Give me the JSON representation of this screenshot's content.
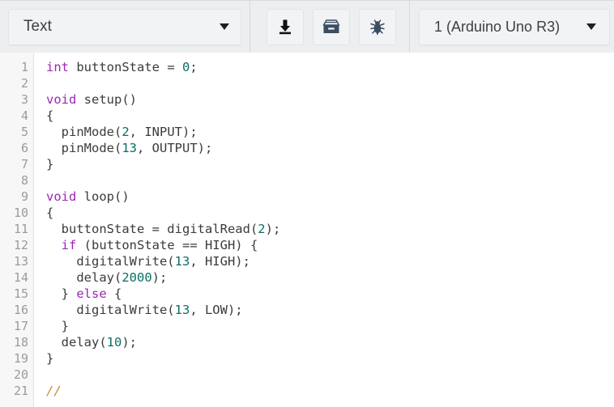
{
  "toolbar": {
    "mode_dropdown": {
      "name": "mode-selector",
      "value": "Text",
      "icon": "chevron-down-icon"
    },
    "buttons": [
      {
        "name": "download-button",
        "icon": "download-icon",
        "label": "Download"
      },
      {
        "name": "archive-button",
        "icon": "archive-icon",
        "label": "Archive"
      },
      {
        "name": "debug-button",
        "icon": "bug-icon",
        "label": "Debug"
      }
    ],
    "board_dropdown": {
      "name": "board-selector",
      "value": "1 (Arduino Uno R3)",
      "icon": "chevron-down-icon"
    }
  },
  "editor": {
    "line_numbers": [
      "1",
      "2",
      "3",
      "4",
      "5",
      "6",
      "7",
      "8",
      "9",
      "10",
      "11",
      "12",
      "13",
      "14",
      "15",
      "16",
      "17",
      "18",
      "19",
      "20",
      "21"
    ],
    "lines": [
      {
        "n": "1",
        "text": "int buttonState = 0;"
      },
      {
        "n": "2",
        "text": ""
      },
      {
        "n": "3",
        "text": "void setup()"
      },
      {
        "n": "4",
        "text": "{"
      },
      {
        "n": "5",
        "text": "  pinMode(2, INPUT);"
      },
      {
        "n": "6",
        "text": "  pinMode(13, OUTPUT);"
      },
      {
        "n": "7",
        "text": "}"
      },
      {
        "n": "8",
        "text": ""
      },
      {
        "n": "9",
        "text": "void loop()"
      },
      {
        "n": "10",
        "text": "{"
      },
      {
        "n": "11",
        "text": "  buttonState = digitalRead(2);"
      },
      {
        "n": "12",
        "text": "  if (buttonState == HIGH) {"
      },
      {
        "n": "13",
        "text": "    digitalWrite(13, HIGH);"
      },
      {
        "n": "14",
        "text": "    delay(2000);"
      },
      {
        "n": "15",
        "text": "  } else {"
      },
      {
        "n": "16",
        "text": "    digitalWrite(13, LOW);"
      },
      {
        "n": "17",
        "text": "  }"
      },
      {
        "n": "18",
        "text": "  delay(10);"
      },
      {
        "n": "19",
        "text": "}"
      },
      {
        "n": "20",
        "text": ""
      },
      {
        "n": "21",
        "text": "//"
      }
    ],
    "tokens": [
      [
        {
          "t": "kw",
          "v": "int"
        },
        {
          "t": "pln",
          "v": " buttonState = "
        },
        {
          "t": "num",
          "v": "0"
        },
        {
          "t": "pln",
          "v": ";"
        }
      ],
      [
        {
          "t": "pln",
          "v": ""
        }
      ],
      [
        {
          "t": "kw",
          "v": "void"
        },
        {
          "t": "pln",
          "v": " setup()"
        }
      ],
      [
        {
          "t": "pln",
          "v": "{"
        }
      ],
      [
        {
          "t": "pln",
          "v": "  pinMode("
        },
        {
          "t": "num",
          "v": "2"
        },
        {
          "t": "pln",
          "v": ", INPUT);"
        }
      ],
      [
        {
          "t": "pln",
          "v": "  pinMode("
        },
        {
          "t": "num",
          "v": "13"
        },
        {
          "t": "pln",
          "v": ", OUTPUT);"
        }
      ],
      [
        {
          "t": "pln",
          "v": "}"
        }
      ],
      [
        {
          "t": "pln",
          "v": ""
        }
      ],
      [
        {
          "t": "kw",
          "v": "void"
        },
        {
          "t": "pln",
          "v": " loop()"
        }
      ],
      [
        {
          "t": "pln",
          "v": "{"
        }
      ],
      [
        {
          "t": "pln",
          "v": "  buttonState = digitalRead("
        },
        {
          "t": "num",
          "v": "2"
        },
        {
          "t": "pln",
          "v": ");"
        }
      ],
      [
        {
          "t": "pln",
          "v": "  "
        },
        {
          "t": "kw",
          "v": "if"
        },
        {
          "t": "pln",
          "v": " (buttonState == HIGH) {"
        }
      ],
      [
        {
          "t": "pln",
          "v": "    digitalWrite("
        },
        {
          "t": "num",
          "v": "13"
        },
        {
          "t": "pln",
          "v": ", HIGH);"
        }
      ],
      [
        {
          "t": "pln",
          "v": "    delay("
        },
        {
          "t": "num",
          "v": "2000"
        },
        {
          "t": "pln",
          "v": ");"
        }
      ],
      [
        {
          "t": "pln",
          "v": "  } "
        },
        {
          "t": "kw",
          "v": "else"
        },
        {
          "t": "pln",
          "v": " {"
        }
      ],
      [
        {
          "t": "pln",
          "v": "    digitalWrite("
        },
        {
          "t": "num",
          "v": "13"
        },
        {
          "t": "pln",
          "v": ", LOW);"
        }
      ],
      [
        {
          "t": "pln",
          "v": "  }"
        }
      ],
      [
        {
          "t": "pln",
          "v": "  delay("
        },
        {
          "t": "num",
          "v": "10"
        },
        {
          "t": "pln",
          "v": ");"
        }
      ],
      [
        {
          "t": "pln",
          "v": "}"
        }
      ],
      [
        {
          "t": "pln",
          "v": ""
        }
      ],
      [
        {
          "t": "com",
          "v": "//"
        }
      ]
    ]
  },
  "colors": {
    "toolbar_bg": "#eceef0",
    "control_bg": "#f2f3f5",
    "control_border": "#e2e4e8",
    "icon": "#3b4d63",
    "editor_bg": "#ffffff",
    "gutter_bg": "#f7f7f7",
    "gutter_text": "#9b9b9b",
    "code_text": "#3b3b3b",
    "keyword": "#9b26b6",
    "number": "#0b6e64",
    "comment": "#c58a3d"
  }
}
